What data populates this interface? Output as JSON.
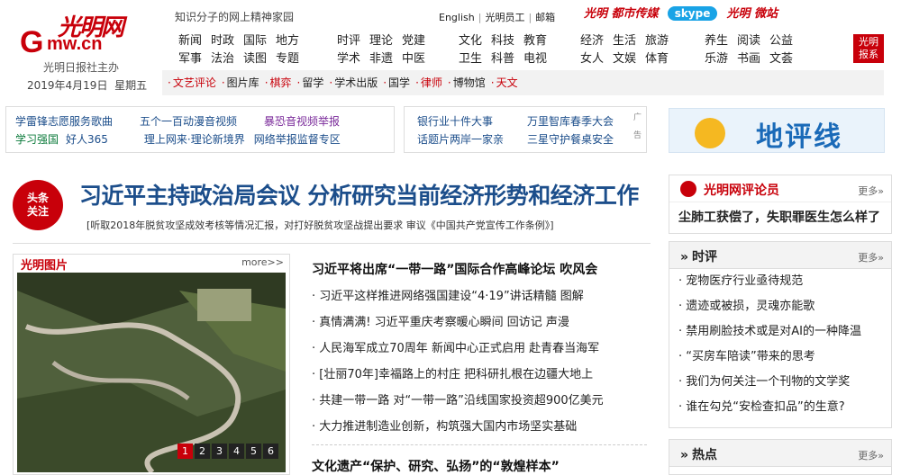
{
  "site": {
    "logo_g": "G",
    "logo_mw": "mw.cn",
    "logo_cal": "光明网",
    "subtitle": "光明日报社主办",
    "date": "2019年4月19日",
    "weekday": "星期五",
    "slogan": "知识分子的网上精神家园"
  },
  "toplinks": [
    "English",
    "光明员工",
    "邮箱"
  ],
  "brands": {
    "b1": "都市传媒",
    "b2": "skype",
    "b3": "微站"
  },
  "nav_cols": [
    [
      [
        "新闻",
        "时政",
        "国际",
        "地方"
      ],
      [
        "军事",
        "法治",
        "读图",
        "专题"
      ]
    ],
    [
      [
        "时评",
        "理论",
        "党建"
      ],
      [
        "学术",
        "非遗",
        "中医"
      ]
    ],
    [
      [
        "文化",
        "科技",
        "教育"
      ],
      [
        "卫生",
        "科普",
        "电视"
      ]
    ],
    [
      [
        "经济",
        "生活",
        "旅游"
      ],
      [
        "女人",
        "文娱",
        "体育"
      ]
    ],
    [
      [
        "养生",
        "阅读",
        "公益"
      ],
      [
        "乐游",
        "书画",
        "文荟"
      ]
    ]
  ],
  "badge": [
    "光明",
    "报系"
  ],
  "subnav": [
    {
      "t": "文艺评论",
      "red": true
    },
    {
      "t": "图片库"
    },
    {
      "t": "棋弈",
      "red": true
    },
    {
      "t": "留学"
    },
    {
      "t": "学术出版"
    },
    {
      "t": "国学"
    },
    {
      "t": "律师",
      "red": true
    },
    {
      "t": "博物馆"
    },
    {
      "t": "天文",
      "red": true
    }
  ],
  "promo": {
    "box1": [
      [
        "学雷锋志愿服务歌曲",
        "五个一百动漫音视频",
        "暴恐音视频举报"
      ],
      [
        "学习强国",
        "好人365",
        "理上网来·理论新境界",
        "网络举报监督专区"
      ]
    ],
    "box2": [
      [
        "银行业十件大事",
        "万里智库春季大会"
      ],
      [
        "话题片两岸一家亲",
        "三星守护餐桌安全"
      ]
    ],
    "ad": "广告",
    "dipb": "地评线"
  },
  "headline": {
    "badge": [
      "头条",
      "关注"
    ],
    "title": "习近平主持政治局会议 分析研究当前经济形势和经济工作",
    "sub": "[听取2018年脱贫攻坚成效考核等情况汇报，对打好脱贫攻坚战提出要求  审议《中国共产党宣传工作条例》]"
  },
  "pic": {
    "title": "光明图片",
    "more": "more>>",
    "pages": [
      "1",
      "2",
      "3",
      "4",
      "5",
      "6"
    ]
  },
  "news": {
    "lead": "习近平将出席“一带一路”国际合作高峰论坛 吹风会",
    "items": [
      "· 习近平这样推进网络强国建设“4·19”讲话精髓  图解",
      "· 真情满满! 习近平重庆考察暖心瞬间  回访记  声漫",
      "· 人民海军成立70周年  新闻中心正式启用  赴青春当海军",
      "· [壮丽70年]幸福路上的村庄  把科研扎根在边疆大地上",
      "· 共建一带一路  对“一带一路”沿线国家投资超900亿美元",
      "· 大力推进制造业创新，构筑强大国内市场坚实基础"
    ],
    "second": "文化遗产“保护、研究、弘扬”的“敦煌样本”"
  },
  "right": {
    "gm": {
      "title": "光明网评论员",
      "more": "更多»",
      "main": "尘肺工获偿了，失职罪医生怎么样了"
    },
    "shiping": {
      "title": "时评",
      "more": "更多»",
      "items": [
        "宠物医疗行业亟待规范",
        "遗迹或被损，灵魂亦能歌",
        "禁用刷脸技术或是对AI的一种降温",
        "“买房车陪读”带来的思考",
        "我们为何关注一个刊物的文学奖",
        "谁在勾兑“安检查扣品”的生意?"
      ]
    },
    "redian": {
      "title": "热点",
      "more": "更多»"
    }
  },
  "colors": {
    "brand": "#c8000a",
    "link": "#1c4e8b"
  }
}
